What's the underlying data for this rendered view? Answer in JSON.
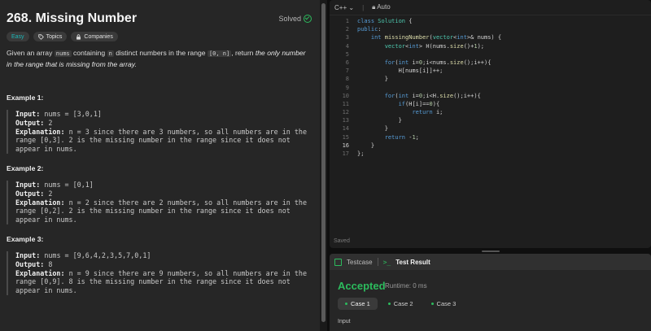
{
  "problem": {
    "title": "268. Missing Number",
    "solved_label": "Solved",
    "tags": [
      "Easy",
      "Topics",
      "Companies"
    ],
    "desc": {
      "p1": "Given an array ",
      "code1": "nums",
      "p2": " containing ",
      "code2": "n",
      "p3": " distinct numbers in the range ",
      "code3": "[0, n]",
      "p4": ", return ",
      "i1": "the only number in the range that is missing from the array."
    },
    "examples": [
      {
        "title": "Example 1:",
        "input_label": "Input:",
        "input": "nums = [3,0,1]",
        "output_label": "Output:",
        "output": "2",
        "expl_label": "Explanation:",
        "expl": "n = 3 since there are 3 numbers, so all numbers are in the range [0,3]. 2 is the missing number in the range since it does not appear in nums."
      },
      {
        "title": "Example 2:",
        "input_label": "Input:",
        "input": "nums = [0,1]",
        "output_label": "Output:",
        "output": "2",
        "expl_label": "Explanation:",
        "expl": "n = 2 since there are 2 numbers, so all numbers are in the range [0,2]. 2 is the missing number in the range since it does not appear in nums."
      },
      {
        "title": "Example 3:",
        "input_label": "Input:",
        "input": "nums = [9,6,4,2,3,5,7,0,1]",
        "output_label": "Output:",
        "output": "8",
        "expl_label": "Explanation:",
        "expl": "n = 9 since there are 9 numbers, so all numbers are in the range [0,9]. 8 is the missing number in the range since it does not appear in nums."
      }
    ]
  },
  "editor": {
    "language": "C++",
    "mode": "Auto",
    "current_line": 16,
    "saved_label": "Saved",
    "lines": [
      "class Solution {",
      "public:",
      "    int missingNumber(vector<int>& nums) {",
      "        vector<int> H(nums.size()+1);",
      "",
      "        for(int i=0;i<nums.size();i++){",
      "            H[nums[i]]++;",
      "        }",
      "",
      "        for(int i=0;i<H.size();i++){",
      "            if(H[i]==0){",
      "                return i;",
      "            }",
      "        }",
      "        return -1;",
      "    }",
      "};"
    ]
  },
  "result": {
    "tab_testcase": "Testcase",
    "tab_result": "Test Result",
    "status": "Accepted",
    "runtime": "Runtime: 0 ms",
    "cases": [
      "Case 1",
      "Case 2",
      "Case 3"
    ],
    "input_label": "Input"
  },
  "colors": {
    "accent_green": "#2cbb5d",
    "easy": "#1cb8b8",
    "panel": "#262626",
    "editor_bg": "#1e1e1e"
  }
}
